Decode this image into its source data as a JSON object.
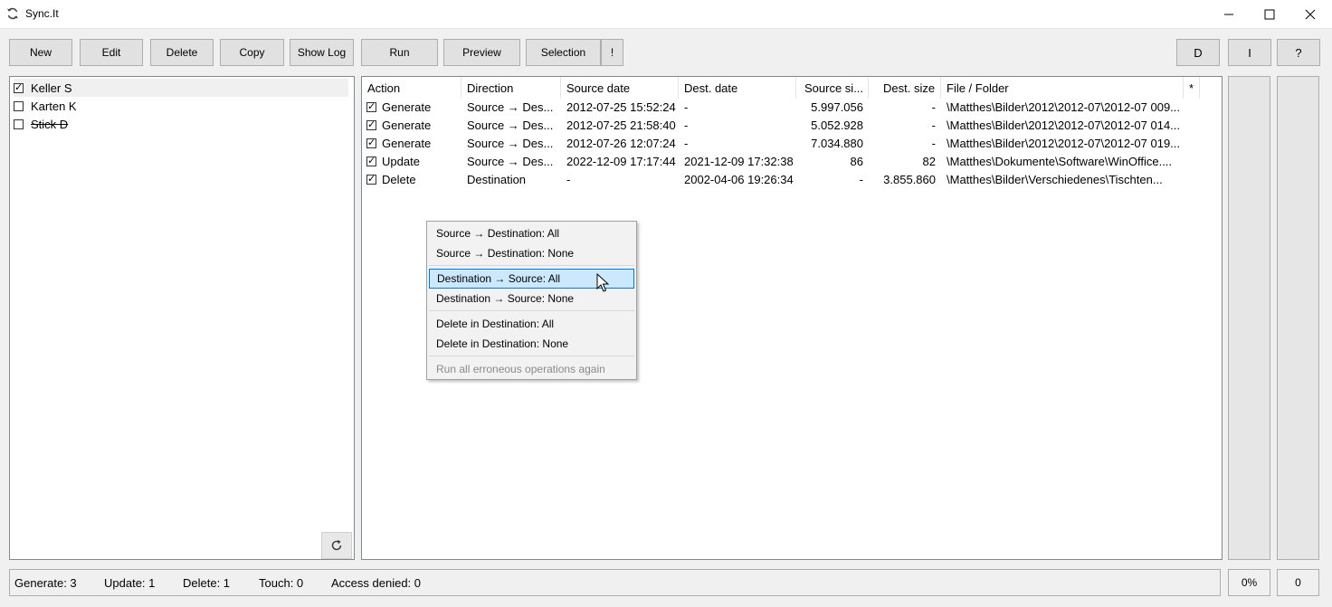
{
  "window": {
    "title": "Sync.It",
    "minimize_icon": "minimize-icon",
    "maximize_icon": "maximize-icon",
    "close_icon": "close-icon"
  },
  "toolbar": {
    "new": "New",
    "edit": "Edit",
    "delete": "Delete",
    "copy": "Copy",
    "show_log": "Show Log",
    "run": "Run",
    "preview": "Preview",
    "selection": "Selection",
    "exclaim": "!",
    "d": "D",
    "i": "I",
    "help": "?"
  },
  "profiles": [
    {
      "label": "Keller S",
      "checked": true,
      "selected": true
    },
    {
      "label": "Karten K",
      "checked": false
    },
    {
      "label": "Stick D",
      "checked": false,
      "strikethrough": true
    }
  ],
  "table": {
    "columns": [
      "Action",
      "Direction",
      "Source date",
      "Dest. date",
      "Source si...",
      "Dest. size",
      "File / Folder",
      "*"
    ],
    "rows": [
      {
        "action": "Generate",
        "direction": "Source → Des...",
        "source_date": "2012-07-25 15:52:24",
        "dest_date": "-",
        "source_size": "5.997.056",
        "dest_size": "-",
        "file": "\\Matthes\\Bilder\\2012\\2012-07\\2012-07 009..."
      },
      {
        "action": "Generate",
        "direction": "Source → Des...",
        "source_date": "2012-07-25 21:58:40",
        "dest_date": "-",
        "source_size": "5.052.928",
        "dest_size": "-",
        "file": "\\Matthes\\Bilder\\2012\\2012-07\\2012-07 014..."
      },
      {
        "action": "Generate",
        "direction": "Source → Des...",
        "source_date": "2012-07-26 12:07:24",
        "dest_date": "-",
        "source_size": "7.034.880",
        "dest_size": "-",
        "file": "\\Matthes\\Bilder\\2012\\2012-07\\2012-07 019..."
      },
      {
        "action": "Update",
        "direction": "Source → Des...",
        "source_date": "2022-12-09 17:17:44",
        "dest_date": "2021-12-09 17:32:38",
        "source_size": "86",
        "dest_size": "82",
        "file": "\\Matthes\\Dokumente\\Software\\WinOffice...."
      },
      {
        "action": "Delete",
        "direction": "Destination",
        "source_date": "-",
        "dest_date": "2002-04-06 19:26:34",
        "source_size": "-",
        "dest_size": "3.855.860",
        "file": "\\Matthes\\Bilder\\Verschiedenes\\Tischten..."
      }
    ]
  },
  "context_menu": {
    "items": [
      "Source → Destination: All",
      "Source → Destination: None",
      "Destination → Source: All",
      "Destination → Source: None",
      "Delete in Destination: All",
      "Delete in Destination: None",
      "Run all erroneous operations again"
    ]
  },
  "status": {
    "generate": "Generate: 3",
    "update": "Update: 1",
    "delete": "Delete: 1",
    "touch": "Touch: 0",
    "access_denied": "Access denied: 0",
    "percent": "0%",
    "count": "0"
  }
}
